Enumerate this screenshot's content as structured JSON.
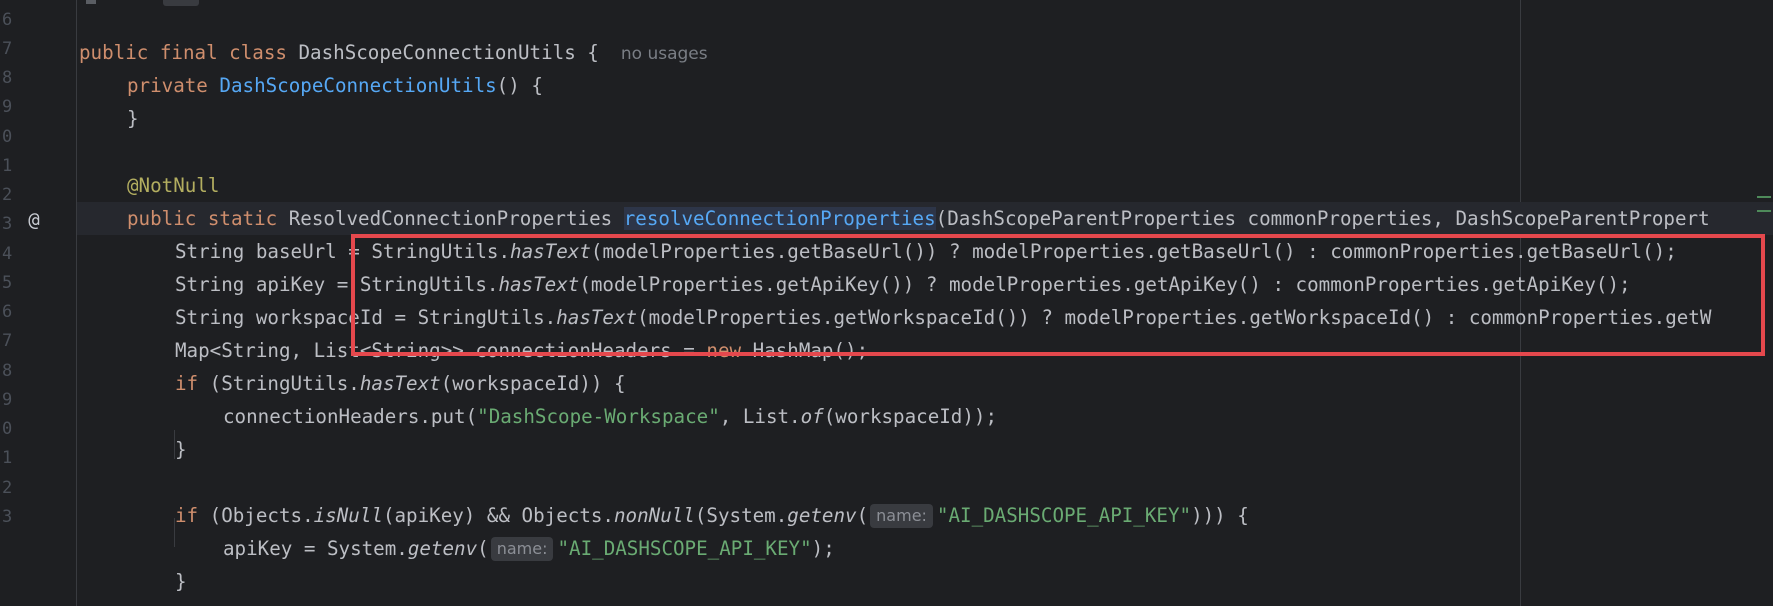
{
  "editor": {
    "line_numbers": [
      "6",
      "7",
      "8",
      "9",
      "0",
      "1",
      "2",
      "3",
      "4",
      "5",
      "6",
      "7",
      "8",
      "9",
      "0",
      "1",
      "2",
      "3"
    ],
    "gutter_marker": "@",
    "usages_hint": "no usages",
    "param_hint": "name:",
    "lines": {
      "l7": {
        "kw1": "public final class ",
        "cls": "DashScopeConnectionUtils {"
      },
      "l8": {
        "kw": "private ",
        "fn": "DashScopeConnectionUtils",
        "rest": "() {"
      },
      "l9": {
        "text": "}"
      },
      "l11": {
        "ann": "@NotNull"
      },
      "l12": {
        "kw": "public static ",
        "type": "ResolvedConnectionProperties ",
        "fn": "resolveConnectionProperties",
        "rest": "(DashScopeParentProperties commonProperties, DashScopeParentPropert"
      },
      "l13": {
        "a": "String baseUrl = StringUtils.",
        "it": "hasText",
        "b": "(modelProperties.getBaseUrl()) ? modelProperties.getBaseUrl() : commonProperties.getBaseUrl();"
      },
      "l14": {
        "a": "String apiKey = StringUtils.",
        "it": "hasText",
        "b": "(modelProperties.getApiKey()) ? modelProperties.getApiKey() : commonProperties.getApiKey();"
      },
      "l15": {
        "a": "String workspaceId = StringUtils.",
        "it": "hasText",
        "b": "(modelProperties.getWorkspaceId()) ? modelProperties.getWorkspaceId() : commonProperties.getW"
      },
      "l16": {
        "a": "Map<String, List<String>> connectionHeaders = ",
        "kw": "new ",
        "b": "HashMap();"
      },
      "l17": {
        "kw": "if ",
        "a": "(StringUtils.",
        "it": "hasText",
        "b": "(workspaceId)) {"
      },
      "l18": {
        "a": "connectionHeaders.put(",
        "str": "\"DashScope-Workspace\"",
        "b": ", List.",
        "it": "of",
        "c": "(workspaceId));"
      },
      "l19": {
        "text": "}"
      },
      "l21": {
        "kw": "if ",
        "a": "(Objects.",
        "it1": "isNull",
        "b": "(apiKey) && Objects.",
        "it2": "nonNull",
        "c": "(System.",
        "it3": "getenv",
        "d": "(",
        "str": "\"AI_DASHSCOPE_API_KEY\"",
        "e": "))) {"
      },
      "l22": {
        "a": "apiKey = System.",
        "it": "getenv",
        "b": "(",
        "str": "\"AI_DASHSCOPE_API_KEY\"",
        "c": ");"
      },
      "l23": {
        "text": "}"
      }
    }
  },
  "colors": {
    "background": "#1e1f22",
    "keyword": "#cf8e6d",
    "function": "#56a8f5",
    "annotation": "#b3ae60",
    "string": "#6aab73",
    "highlight_box": "#e5484d"
  }
}
